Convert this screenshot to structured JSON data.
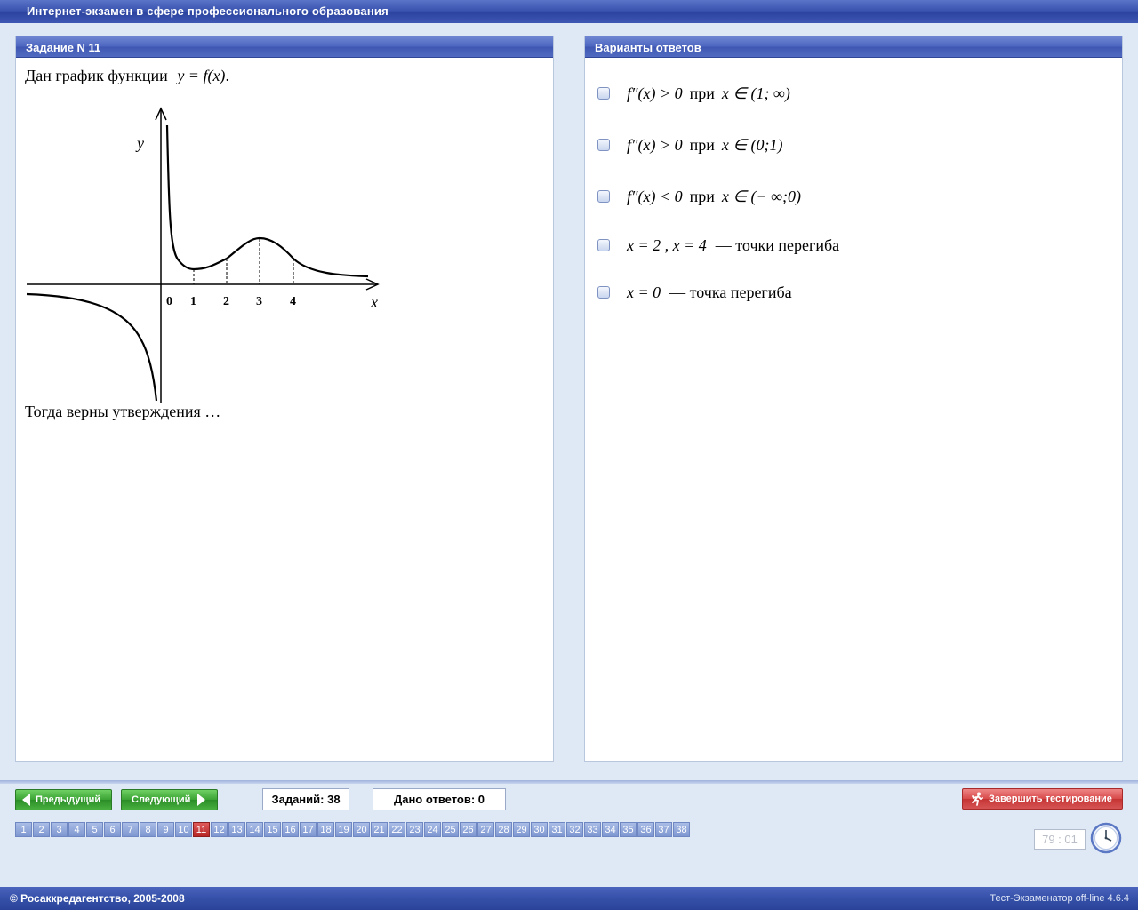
{
  "window": {
    "title": "Интернет-экзамен в сфере профессионального образования"
  },
  "task": {
    "header": "Задание N 11",
    "intro_prefix": "Дан график функции",
    "intro_formula": "y = f(x)",
    "intro_suffix": ".",
    "question": "Тогда верны утверждения …",
    "graph": {
      "y_label": "y",
      "x_label": "x",
      "origin_label": "0",
      "x_ticks": [
        "1",
        "2",
        "3",
        "4"
      ]
    }
  },
  "answers": {
    "header": "Варианты ответов",
    "options": [
      {
        "lhs": "f″(x) > 0",
        "word": "при",
        "set": "x ∈ (1; ∞)"
      },
      {
        "lhs": "f″(x) > 0",
        "word": "при",
        "set": "x ∈ (0;1)"
      },
      {
        "lhs": "f″(x) < 0",
        "word": "при",
        "set": "x ∈ (− ∞;0)"
      },
      {
        "lhs": "x = 2 ,  x = 4",
        "word": "— точки перегиба",
        "set": ""
      },
      {
        "lhs": "x = 0",
        "word": "— точка перегиба",
        "set": ""
      }
    ]
  },
  "toolbar": {
    "prev_label": "Предыдущий",
    "next_label": "Следующий",
    "total_label": "Заданий: 38",
    "answered_label": "Дано ответов: 0",
    "finish_label": "Завершить тестирование"
  },
  "navigation": {
    "current": "11",
    "items": [
      "1",
      "2",
      "3",
      "4",
      "5",
      "6",
      "7",
      "8",
      "9",
      "10",
      "11",
      "12",
      "13",
      "14",
      "15",
      "16",
      "17",
      "18",
      "19",
      "20",
      "21",
      "22",
      "23",
      "24",
      "25",
      "26",
      "27",
      "28",
      "29",
      "30",
      "31",
      "32",
      "33",
      "34",
      "35",
      "36",
      "37",
      "38"
    ]
  },
  "timer": {
    "value": "79 : 01"
  },
  "footer": {
    "copyright": "© Росаккредагентство, 2005-2008",
    "version": "Тест-Экзаменатор off-line 4.6.4"
  },
  "colors": {
    "title_bar": "#3b54b0",
    "panel_header": "#4c66c0",
    "button_green": "#3aa333",
    "button_red": "#d84a4a",
    "active_nav": "#b62626"
  }
}
